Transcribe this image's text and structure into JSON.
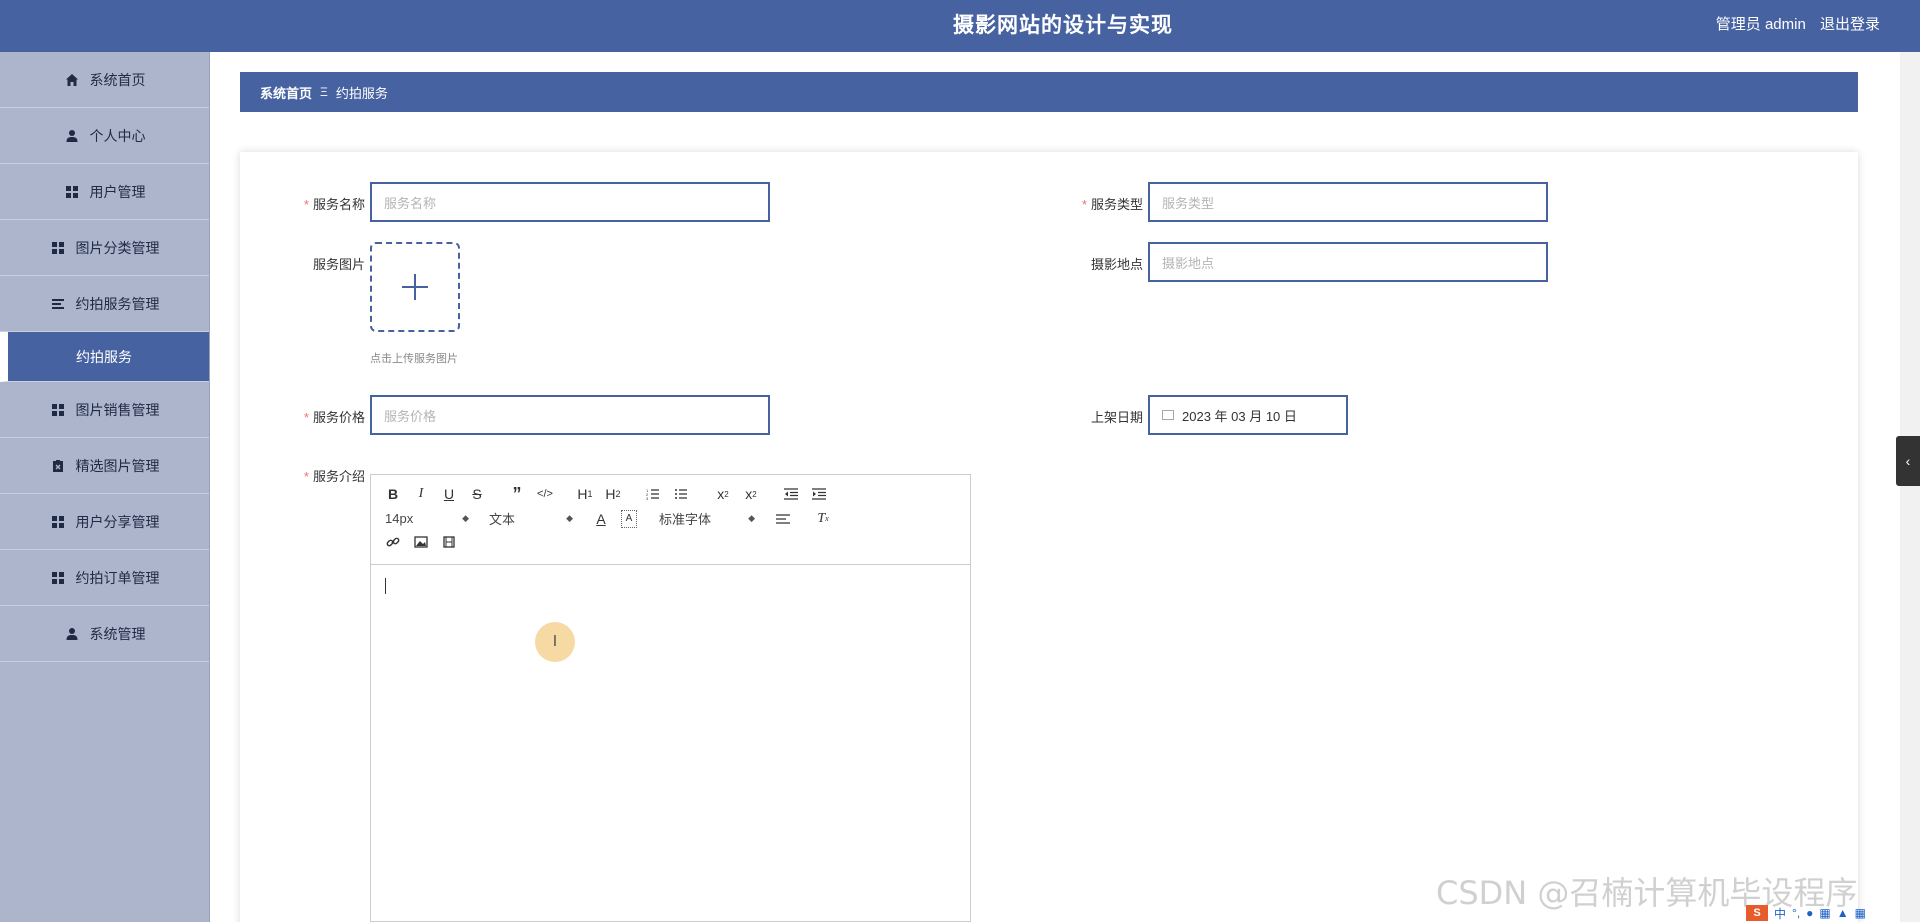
{
  "header": {
    "title": "摄影网站的设计与实现",
    "user_label": "管理员 admin",
    "logout": "退出登录"
  },
  "sidebar": {
    "items": [
      {
        "label": "系统首页",
        "icon": "home-icon"
      },
      {
        "label": "个人中心",
        "icon": "user-icon"
      },
      {
        "label": "用户管理",
        "icon": "grid-icon"
      },
      {
        "label": "图片分类管理",
        "icon": "grid-icon"
      },
      {
        "label": "约拍服务管理",
        "icon": "list-icon"
      },
      {
        "label": "约拍服务",
        "icon": "",
        "active": true
      },
      {
        "label": "图片销售管理",
        "icon": "grid-icon"
      },
      {
        "label": "精选图片管理",
        "icon": "clipboard-icon"
      },
      {
        "label": "用户分享管理",
        "icon": "grid-icon"
      },
      {
        "label": "约拍订单管理",
        "icon": "grid-icon"
      },
      {
        "label": "系统管理",
        "icon": "user-icon"
      }
    ]
  },
  "breadcrumb": {
    "home": "系统首页",
    "sep": "Ξ",
    "current": "约拍服务"
  },
  "form": {
    "service_name": {
      "label": "服务名称",
      "placeholder": "服务名称",
      "required": true
    },
    "service_type": {
      "label": "服务类型",
      "placeholder": "服务类型",
      "required": true
    },
    "service_image": {
      "label": "服务图片",
      "hint": "点击上传服务图片"
    },
    "location": {
      "label": "摄影地点",
      "placeholder": "摄影地点"
    },
    "price": {
      "label": "服务价格",
      "placeholder": "服务价格",
      "required": true
    },
    "listing_date": {
      "label": "上架日期",
      "value": "2023 年 03 月 10 日"
    },
    "intro": {
      "label": "服务介绍",
      "required": true
    }
  },
  "editor": {
    "font_size": "14px",
    "paragraph": "文本",
    "font_family": "标准字体"
  },
  "watermark": "CSDN @召楠计算机毕设程序",
  "tray": {
    "ime": "中"
  },
  "colors": {
    "primary": "#4662a1",
    "sidebar": "#adb5cd",
    "required": "#f56c6c"
  }
}
